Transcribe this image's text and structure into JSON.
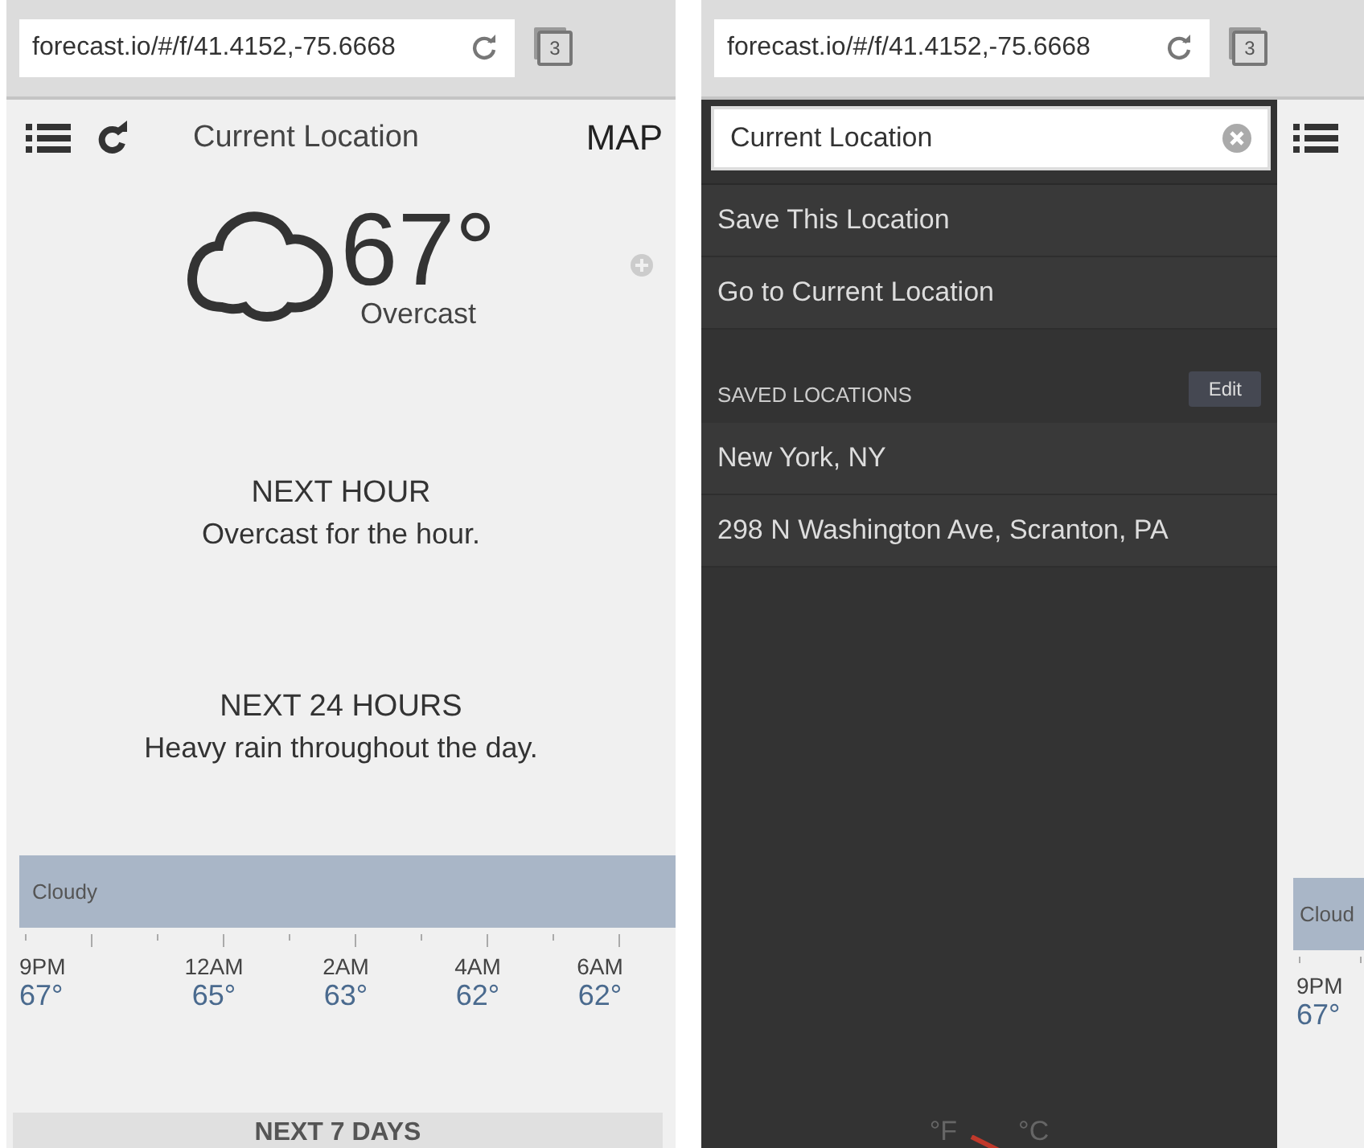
{
  "main_screen": {
    "browser": {
      "url": "forecast.io/#/f/41.4152,-75.6668",
      "tab_count": "3"
    },
    "header": {
      "title": "Current Location",
      "map": "MAP"
    },
    "current": {
      "temperature": "67°",
      "summary": "Overcast"
    },
    "next_hour": {
      "heading": "NEXT HOUR",
      "text": "Overcast for the hour."
    },
    "next_24_hours": {
      "heading": "NEXT 24 HOURS",
      "text": "Heavy rain throughout the day."
    },
    "timeline": {
      "label": "Cloudy",
      "hours": [
        {
          "time": "9PM",
          "temp": "67°"
        },
        {
          "time": "12AM",
          "temp": "65°"
        },
        {
          "time": "2AM",
          "temp": "63°"
        },
        {
          "time": "4AM",
          "temp": "62°"
        },
        {
          "time": "6AM",
          "temp": "62°"
        }
      ]
    },
    "next_7_days": "NEXT 7 DAYS"
  },
  "menu_screen": {
    "browser": {
      "url": "forecast.io/#/f/41.4152,-75.6668",
      "tab_count": "3"
    },
    "search": {
      "value": "Current Location"
    },
    "actions": [
      "Save This Location",
      "Go to Current Location"
    ],
    "saved": {
      "heading": "SAVED LOCATIONS",
      "edit": "Edit",
      "items": [
        "New York, NY",
        "298 N Washington Ave, Scranton, PA"
      ]
    },
    "units": [
      "°F",
      "°C"
    ],
    "behind": {
      "label": "Cloud",
      "time": "9PM",
      "temp": "67°"
    }
  }
}
